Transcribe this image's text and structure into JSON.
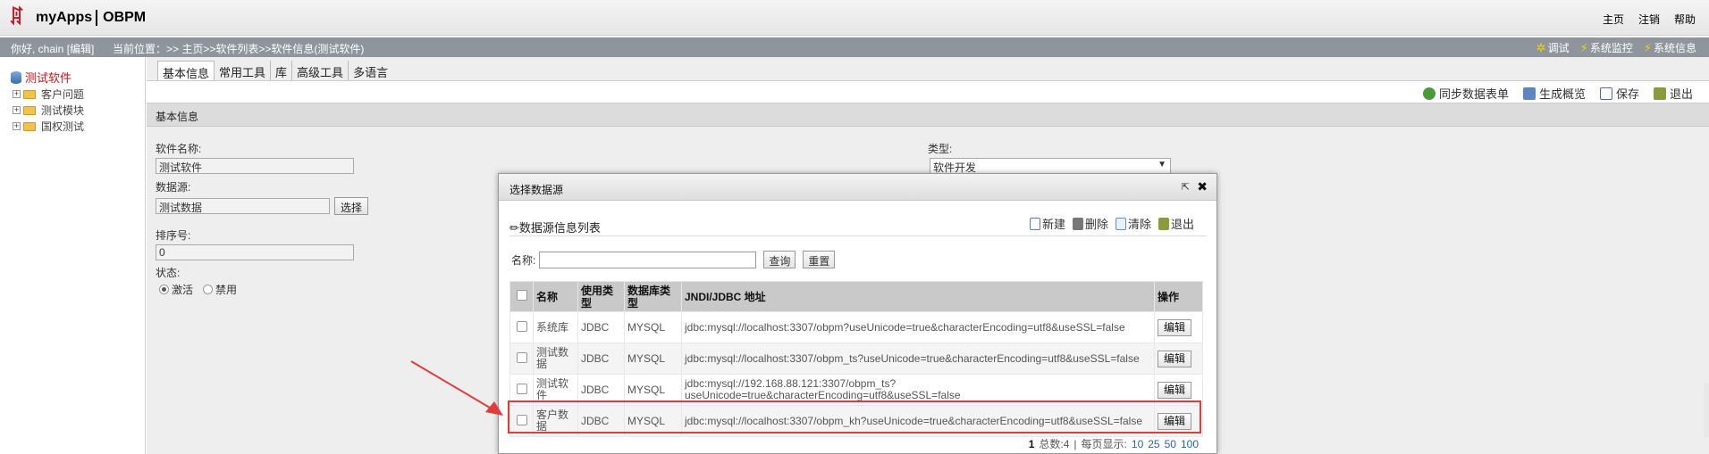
{
  "header": {
    "logo_mark": "ꁲ",
    "app_name": "myApps",
    "product": "OBPM",
    "links": [
      "主页",
      "注销",
      "帮助"
    ]
  },
  "status": {
    "greeting": "你好, chain [编辑]",
    "breadcrumb": "当前位置：>> 主页>>软件列表>>软件信息(测试软件)",
    "tools": [
      "调试",
      "系统监控",
      "系统信息"
    ]
  },
  "sidebar": {
    "root": "测试软件",
    "nodes": [
      "客户问题",
      "测试模块",
      "国权测试"
    ]
  },
  "tabs": [
    "基本信息",
    "常用工具",
    "库",
    "高级工具",
    "多语言"
  ],
  "toolbar": [
    "同步数据表单",
    "生成概览",
    "保存",
    "退出"
  ],
  "section_title": "基本信息",
  "form": {
    "name_label": "软件名称:",
    "name_value": "测试软件",
    "datasource_label": "数据源:",
    "datasource_value": "测试数据",
    "select_button": "选择",
    "order_label": "排序号:",
    "order_value": "0",
    "status_label": "状态:",
    "status_active": "激活",
    "status_disabled": "禁用",
    "type_label": "类型:",
    "type_value": "软件开发"
  },
  "dialog": {
    "title": "选择数据源",
    "list_title": "数据源信息列表",
    "actions": [
      "新建",
      "删除",
      "清除",
      "退出"
    ],
    "search_label": "名称:",
    "query_button": "查询",
    "reset_button": "重置",
    "columns": [
      "名称",
      "使用类型",
      "数据库类型",
      "JNDI/JDBC 地址",
      "操作"
    ],
    "rows": [
      {
        "name": "系统库",
        "use_type": "JDBC",
        "db_type": "MYSQL",
        "url": "jdbc:mysql://localhost:3307/obpm?useUnicode=true&characterEncoding=utf8&useSSL=false",
        "op": "编辑"
      },
      {
        "name": "测试数据",
        "use_type": "JDBC",
        "db_type": "MYSQL",
        "url": "jdbc:mysql://localhost:3307/obpm_ts?useUnicode=true&characterEncoding=utf8&useSSL=false",
        "op": "编辑"
      },
      {
        "name": "测试软件",
        "use_type": "JDBC",
        "db_type": "MYSQL",
        "url": "jdbc:mysql://192.168.88.121:3307/obpm_ts?useUnicode=true&characterEncoding=utf8&useSSL=false",
        "op": "编辑"
      },
      {
        "name": "客户数据",
        "use_type": "JDBC",
        "db_type": "MYSQL",
        "url": "jdbc:mysql://localhost:3307/obpm_kh?useUnicode=true&characterEncoding=utf8&useSSL=false",
        "op": "编辑"
      }
    ],
    "pager": {
      "current": "1",
      "total": "总数:4",
      "sep": "|",
      "per_page_label": "每页显示:",
      "sizes": [
        "10",
        "25",
        "50",
        "100"
      ]
    }
  },
  "colors": {
    "highlight": "#e23b3b",
    "brand": "#c8161d"
  }
}
